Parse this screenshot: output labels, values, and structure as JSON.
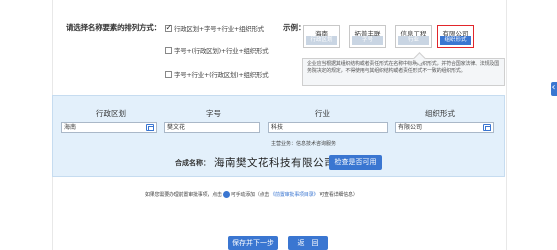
{
  "form": {
    "arrange_label": "请选择名称要素的排列方式：",
    "options": [
      {
        "label": "行政区划+字号+行业+组织形式",
        "checked": true
      },
      {
        "label": "字号+(行政区划)+行业+组织形式",
        "checked": false
      },
      {
        "label": "字号+行业+(行政区划)+组织形式",
        "checked": false
      }
    ],
    "example_label": "示例：",
    "examples": [
      {
        "title": "海南",
        "sub": "行政区划",
        "active": false
      },
      {
        "title": "拓普丰联",
        "sub": "字号",
        "active": false
      },
      {
        "title": "信息工程",
        "sub": "行业",
        "active": false
      },
      {
        "title": "有限公司",
        "sub": "组织形式",
        "active": true
      }
    ],
    "tip": "企业应当根据其组织结构或者责任形式在名称中标明组织形式，并符合国家法律、法规及国务院决定的规定，不得使用与其组织结构或者责任形式不一致的组织形式。"
  },
  "parts": {
    "headers": [
      "行政区划",
      "字号",
      "行业",
      "组织形式"
    ],
    "values": [
      "海南",
      "樊文花",
      "科技",
      "有限公司"
    ],
    "industry_note": "主营业务：信息技术咨询服务"
  },
  "result": {
    "label": "名称：",
    "label_prefix": "合成",
    "value": "海南樊文花科技有限公司",
    "check_button": "检查是否可用"
  },
  "hint": {
    "before": "如果您需要办理前置审批事项，点击",
    "after": "可手动添加（点击",
    "link": "《前置审批事项目录》",
    "end": "可查看详细信息）"
  },
  "buttons": {
    "save": "保存并下一步",
    "back": "返　回"
  },
  "colors": {
    "accent": "#3a76d1",
    "active_border": "#e1262b",
    "panel_bg": "#e3f0fb"
  }
}
